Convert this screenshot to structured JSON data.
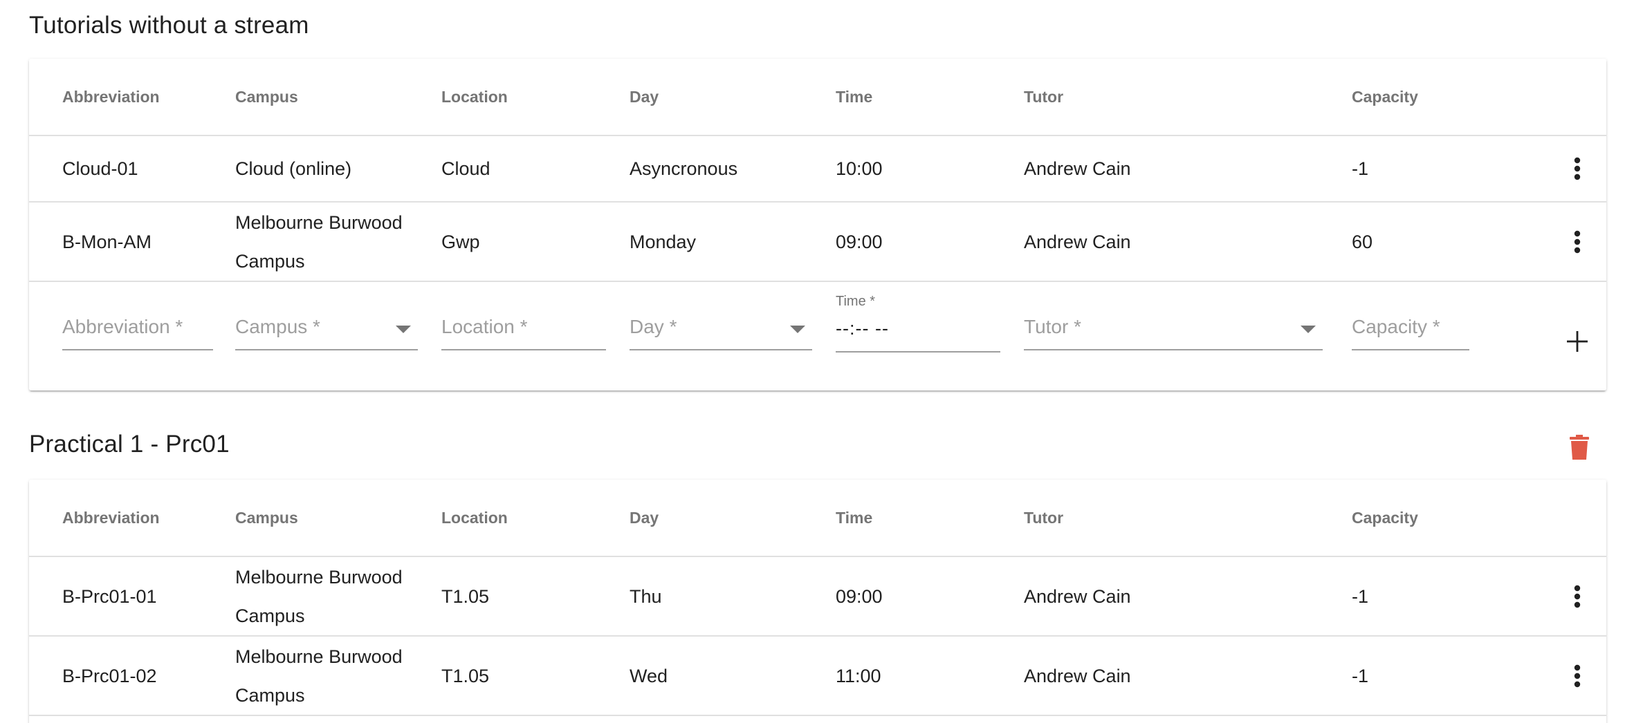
{
  "section1": {
    "title": "Tutorials without a stream",
    "headers": [
      "Abbreviation",
      "Campus",
      "Location",
      "Day",
      "Time",
      "Tutor",
      "Capacity"
    ],
    "rows": [
      {
        "abbr": "Cloud-01",
        "campus": "Cloud (online)",
        "location": "Cloud",
        "day": "Asyncronous",
        "time": "10:00",
        "tutor": "Andrew Cain",
        "capacity": "-1"
      },
      {
        "abbr": "B-Mon-AM",
        "campus": "Melbourne Burwood Campus",
        "location": "Gwp",
        "day": "Monday",
        "time": "09:00",
        "tutor": "Andrew Cain",
        "capacity": "60"
      }
    ],
    "form": {
      "abbr_placeholder": "Abbreviation *",
      "campus_placeholder": "Campus *",
      "location_placeholder": "Location *",
      "day_placeholder": "Day *",
      "time_label": "Time *",
      "time_value": "--:-- --",
      "tutor_placeholder": "Tutor *",
      "capacity_placeholder": "Capacity *"
    }
  },
  "section2": {
    "title": "Practical 1 - Prc01",
    "headers": [
      "Abbreviation",
      "Campus",
      "Location",
      "Day",
      "Time",
      "Tutor",
      "Capacity"
    ],
    "rows": [
      {
        "abbr": "B-Prc01-01",
        "campus": "Melbourne Burwood Campus",
        "location": "T1.05",
        "day": "Thu",
        "time": "09:00",
        "tutor": "Andrew Cain",
        "capacity": "-1"
      },
      {
        "abbr": "B-Prc01-02",
        "campus": "Melbourne Burwood Campus",
        "location": "T1.05",
        "day": "Wed",
        "time": "11:00",
        "tutor": "Andrew Cain",
        "capacity": "-1"
      }
    ]
  },
  "icons": {
    "delete": "trash-icon",
    "row_menu": "more-vert-icon",
    "add": "plus-icon",
    "dropdown": "arrow-drop-down-icon"
  },
  "colors": {
    "delete_red": "#e05a47",
    "header_text": "#757575",
    "divider": "#e0e0e0"
  }
}
